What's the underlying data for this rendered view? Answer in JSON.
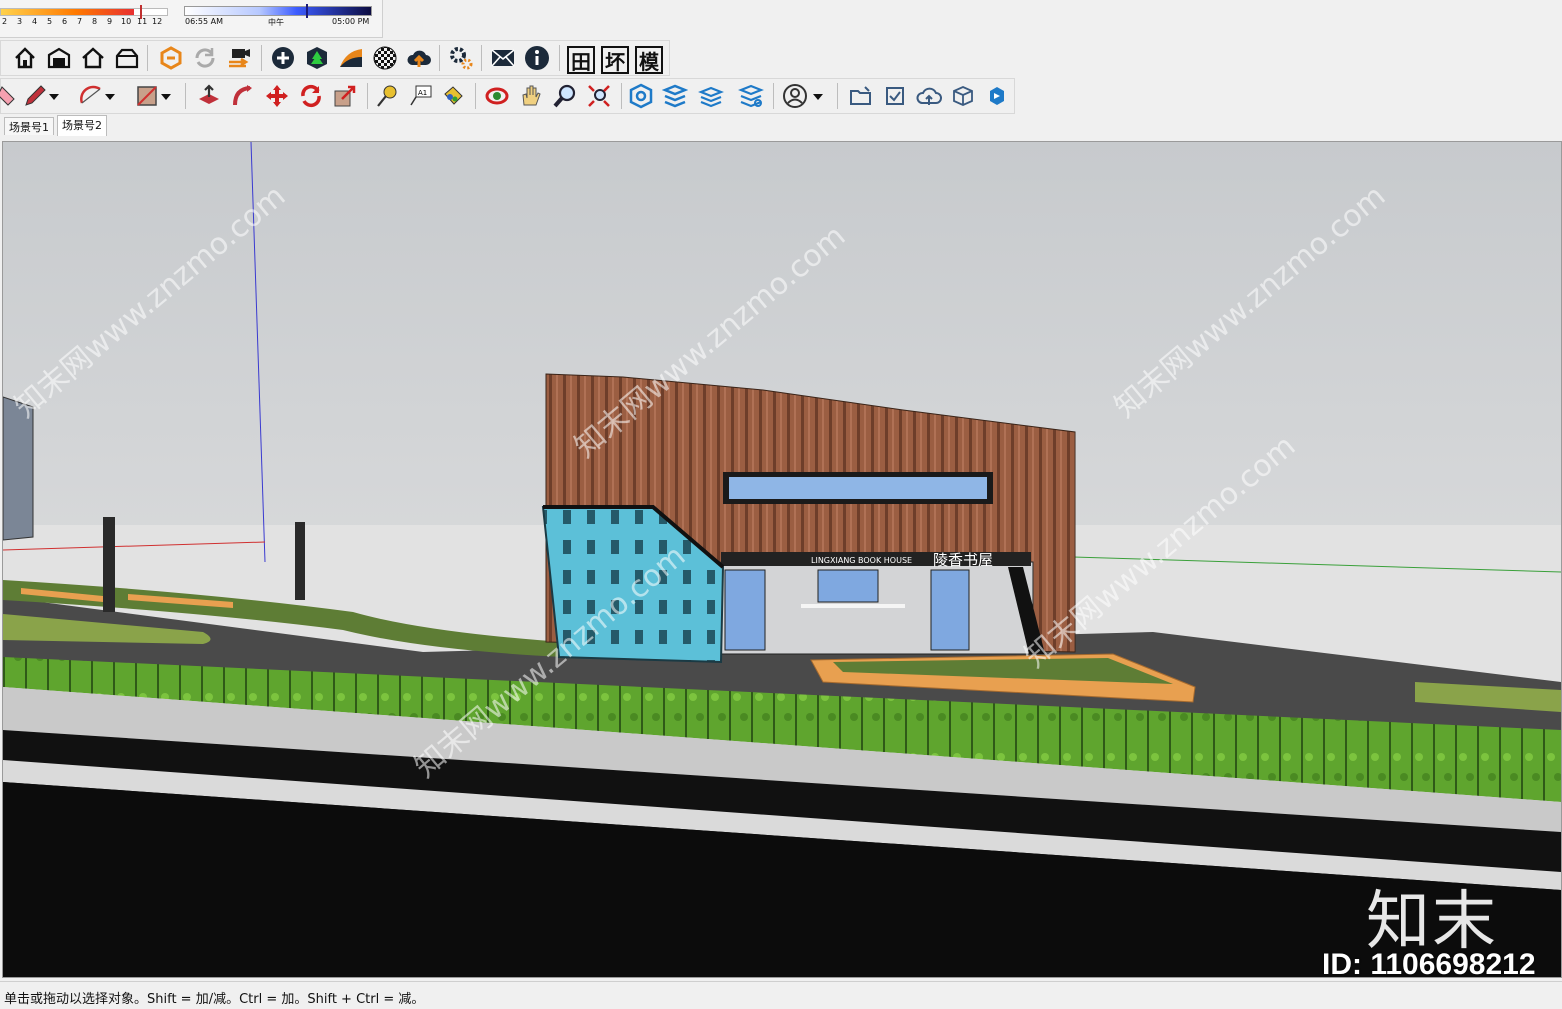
{
  "shadow_settings": {
    "month_ticks": [
      "2",
      "3",
      "4",
      "5",
      "6",
      "7",
      "8",
      "9",
      "10",
      "11",
      "12"
    ],
    "time_start": "06:55 AM",
    "time_noon": "中午",
    "time_end": "05:00 PM"
  },
  "toolbar_row1": {
    "icons": [
      "home-icon",
      "warehouse-icon",
      "house-outline-icon",
      "barn-icon",
      "extension-warehouse-icon",
      "refresh-icon",
      "video-camera-icon",
      "add-circle-icon",
      "tree-shield-icon",
      "terrain-icon",
      "checker-sphere-icon",
      "cloud-upload-icon",
      "gears-icon",
      "mail-icon",
      "info-icon",
      "grid-text-icon",
      "huan-text-icon",
      "mo-text-icon"
    ],
    "text_buttons": [
      "田",
      "坏",
      "模"
    ]
  },
  "toolbar_row2": {
    "icons": [
      "eraser-icon",
      "pencil-icon",
      "dropdown-arrow-icon",
      "arc-icon",
      "dropdown-arrow-icon",
      "rectangle-icon",
      "dropdown-arrow-icon",
      "push-pull-icon",
      "follow-me-icon",
      "move-icon",
      "rotate-icon",
      "scale-icon",
      "tape-measure-icon",
      "text-label-icon",
      "paint-bucket-icon",
      "orbit-icon",
      "pan-icon",
      "zoom-icon",
      "zoom-extents-icon",
      "components-icon",
      "styles-icon",
      "layers-icon",
      "section-icon",
      "user-icon",
      "dropdown-arrow-icon",
      "open-folder-icon",
      "checkbox-icon",
      "cloud-icon",
      "box-3d-icon",
      "sync-icon"
    ]
  },
  "scene_tabs": [
    "场景号1",
    "场景号2"
  ],
  "active_scene": 1,
  "viewport": {
    "facade_sign_en": "LINGXIANG BOOK HOUSE",
    "facade_sign_cn": "陵香书屋"
  },
  "watermark": {
    "text": "知末网www.znzmo.com",
    "logo": "知末",
    "id": "ID: 1106698212"
  },
  "status_bar": {
    "text": "单击或拖动以选择对象。Shift = 加/减。Ctrl = 加。Shift + Ctrl = 减。"
  },
  "colors": {
    "sky_top": "#c8cbcf",
    "sky_bottom": "#e6e6e6",
    "facade_wood": "#9a5c3f",
    "glass_blue": "#5bb8d4",
    "grass": "#5a9a2a",
    "road": "#111111"
  }
}
